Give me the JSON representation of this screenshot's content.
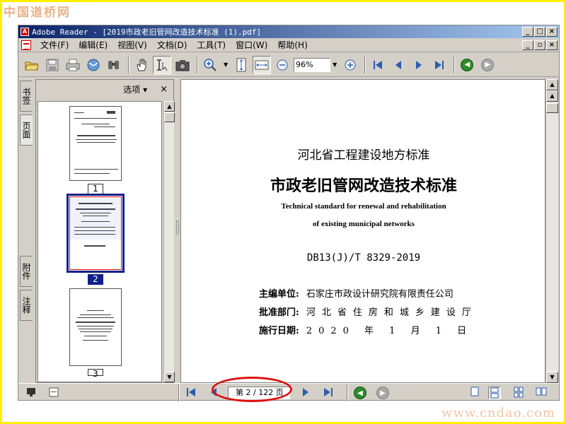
{
  "watermarks": {
    "top": "中国道桥网",
    "bottom": "www.cndao.com"
  },
  "window": {
    "title": "Adobe Reader - [2019市政老旧管网改造技术标准 (1).pdf]",
    "controls": {
      "minimize": "_",
      "maximize": "□",
      "close": "×"
    }
  },
  "menu": {
    "items": [
      "文件(F)",
      "编辑(E)",
      "视图(V)",
      "文档(D)",
      "工具(T)",
      "窗口(W)",
      "帮助(H)"
    ],
    "controls": {
      "minimize": "_",
      "restore": "▫",
      "close": "×"
    }
  },
  "toolbar": {
    "zoom": "96%",
    "icons": [
      "open-icon",
      "save-icon",
      "print-icon",
      "email-icon",
      "search-icon",
      "hand-tool-icon",
      "select-text-icon",
      "snapshot-icon",
      "zoom-in-tool-icon",
      "fit-page-icon",
      "fit-width-icon",
      "zoom-out-icon",
      "zoom-plus-icon",
      "first-page-icon",
      "prev-page-icon",
      "next-page-icon",
      "last-page-icon",
      "go-back-icon",
      "go-forward-icon"
    ]
  },
  "sidetabs": {
    "bookmarks": "书签",
    "pages": "页面",
    "attachments": "附件",
    "comments": "注释"
  },
  "panel": {
    "options_label": "选项 ▾",
    "close": "×",
    "thumbnails": [
      {
        "label": "1",
        "selected": false
      },
      {
        "label": "2",
        "selected": true
      },
      {
        "label": "3",
        "selected": false
      }
    ]
  },
  "document": {
    "heading": "河北省工程建设地方标准",
    "title": "市政老旧管网改造技术标准",
    "subtitle_en_1": "Technical standard for renewal and rehabilitation",
    "subtitle_en_2": "of existing municipal networks",
    "code": "DB13(J)/T 8329-2019",
    "info": [
      {
        "key": "主编单位:",
        "value": "石家庄市政设计研究院有限责任公司"
      },
      {
        "key": "批准部门:",
        "value": "河北省住房和城乡建设厅"
      },
      {
        "key": "施行日期:",
        "value": "2020 年 1 月 1 日"
      }
    ]
  },
  "statusbar": {
    "page_indicator": "第 2 / 122 页",
    "current_page": 2,
    "total_pages": 122
  },
  "colors": {
    "highlight": "#e01010",
    "frame": "#ffee00",
    "selection": "#10208a"
  }
}
